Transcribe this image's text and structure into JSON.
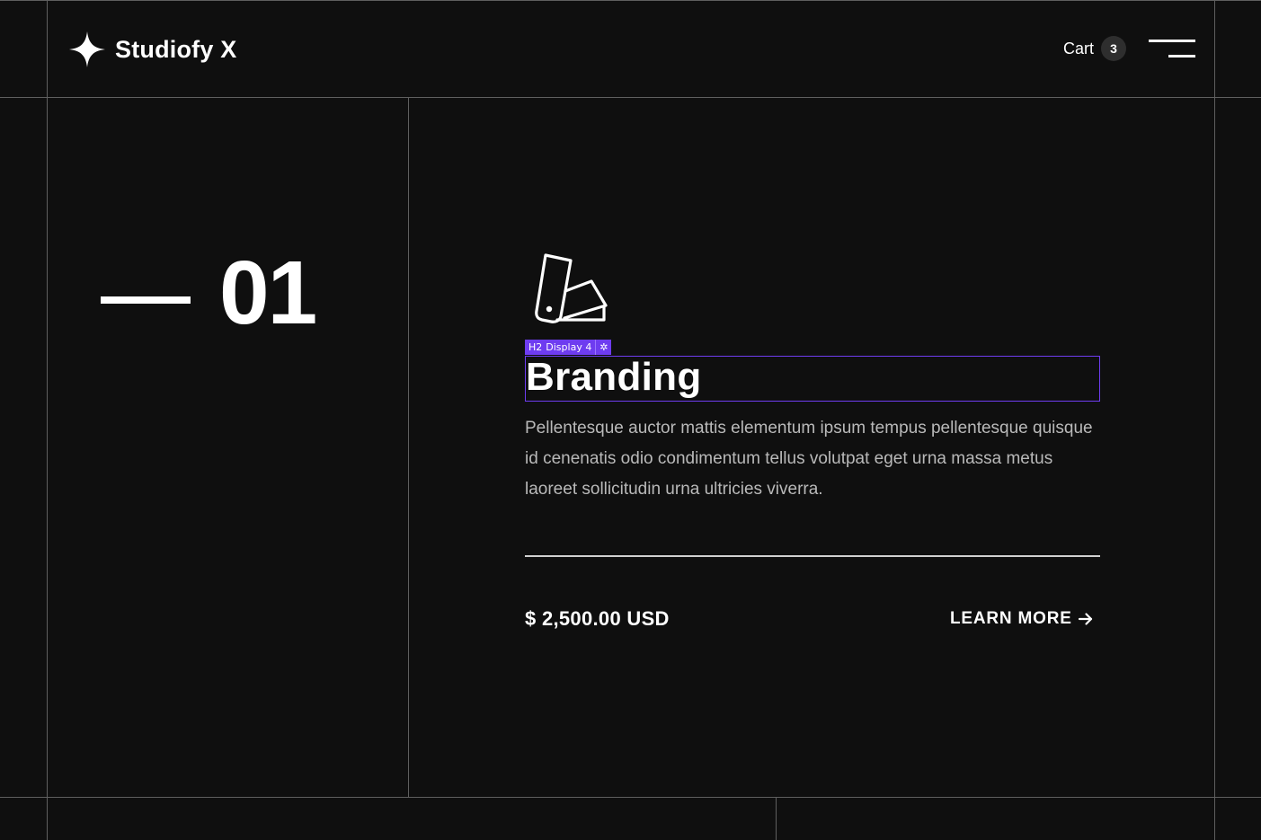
{
  "header": {
    "brand": "Studiofy X",
    "logo_icon": "four-point-star-icon",
    "cart_label": "Cart",
    "cart_count": "3",
    "menu_icon": "hamburger-menu-icon"
  },
  "service": {
    "number": "01",
    "icon": "color-swatch-icon",
    "editor_tag": {
      "heading_level": "H2",
      "style_name": "Display 4",
      "settings_icon": "gear-icon"
    },
    "title": "Branding",
    "description": "Pellentesque auctor mattis elementum ipsum tempus pellentesque quisque id cenenatis odio condimentum tellus volutpat eget urna massa metus laoreet sollicitudin urna ultricies viverra.",
    "price": "$ 2,500.00 USD",
    "cta_label": "LEARN MORE",
    "cta_icon": "arrow-right-icon"
  },
  "colors": {
    "background": "#0f0f0f",
    "grid_lines": "#5f5f5f",
    "text_primary": "#ffffff",
    "text_secondary": "#b9b9b9",
    "editor_accent": "#6e3cf0"
  }
}
